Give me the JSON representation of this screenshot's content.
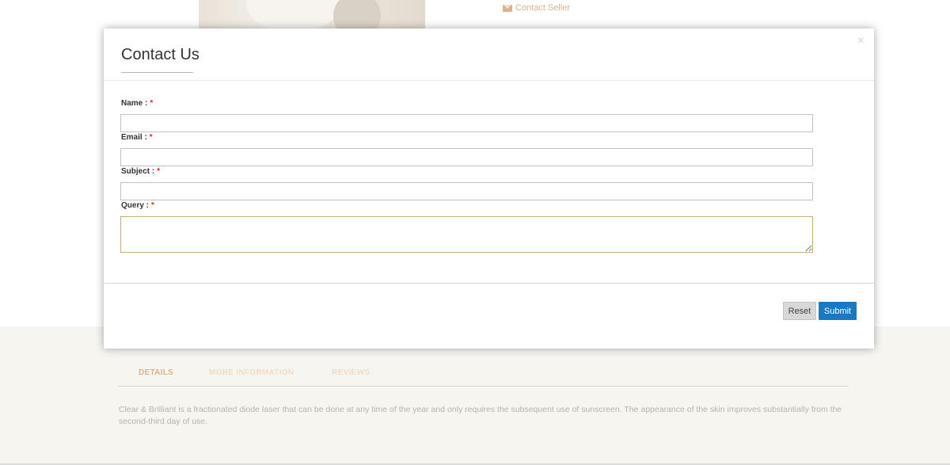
{
  "background": {
    "contact_seller": "Contact Seller",
    "tabs": [
      "DETAILS",
      "MORE INFORMATION",
      "REVIEWS"
    ],
    "description": "Clear & Brilliant is a fractionated diode laser that can be done at any time of the year and only requires the subsequent use of sunscreen. The appearance of the skin improves substantially from the second-third day of use."
  },
  "modal": {
    "close": "×",
    "title": "Contact Us",
    "fields": {
      "name": {
        "label": "Name :",
        "required": "*",
        "value": ""
      },
      "email": {
        "label": "Email :",
        "required": "*",
        "value": ""
      },
      "subject": {
        "label": "Subject :",
        "required": "*",
        "value": ""
      },
      "query": {
        "label": "Query :",
        "required": "*",
        "value": ""
      }
    },
    "buttons": {
      "reset": "Reset",
      "submit": "Submit"
    }
  },
  "colors": {
    "accent": "#d9b58e",
    "submit": "#1979c3",
    "required": "#e02b27"
  },
  "icons": {
    "contact_seller": "envelope-icon",
    "close": "close-icon"
  }
}
